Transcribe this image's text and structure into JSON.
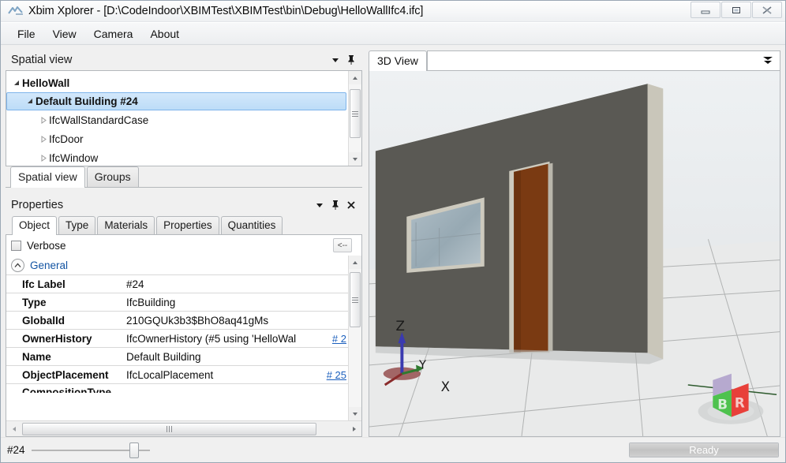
{
  "window": {
    "title": "Xbim Xplorer - [D:\\CodeIndoor\\XBIMTest\\XBIMTest\\bin\\Debug\\HelloWallIfc4.ifc]",
    "app_icon": "xbim-logo-icon",
    "controls": [
      {
        "name": "minimize-button",
        "glyph": "minimize-icon"
      },
      {
        "name": "restore-button",
        "glyph": "restore-icon"
      },
      {
        "name": "close-button",
        "glyph": "close-icon"
      }
    ]
  },
  "menubar": {
    "items": [
      {
        "label": "File"
      },
      {
        "label": "View"
      },
      {
        "label": "Camera"
      },
      {
        "label": "About"
      }
    ]
  },
  "spatial_panel": {
    "title": "Spatial view",
    "header_buttons": [
      {
        "name": "panel-menu-button",
        "icon": "chevron-down-icon"
      },
      {
        "name": "panel-pin-button",
        "icon": "pin-icon"
      }
    ],
    "tree": [
      {
        "label": "HelloWall",
        "level": 0,
        "expander": "expanded",
        "selected": false
      },
      {
        "label": "Default Building #24",
        "level": 1,
        "expander": "expanded",
        "selected": true
      },
      {
        "label": "IfcWallStandardCase",
        "level": 2,
        "expander": "collapsed",
        "selected": false
      },
      {
        "label": "IfcDoor",
        "level": 2,
        "expander": "collapsed",
        "selected": false
      },
      {
        "label": "IfcWindow",
        "level": 2,
        "expander": "collapsed",
        "selected": false
      }
    ],
    "tabs": [
      {
        "label": "Spatial view",
        "active": true
      },
      {
        "label": "Groups",
        "active": false
      }
    ]
  },
  "properties_panel": {
    "title": "Properties",
    "header_buttons": [
      {
        "name": "panel-menu-button",
        "icon": "chevron-down-icon"
      },
      {
        "name": "panel-pin-button",
        "icon": "pin-icon"
      },
      {
        "name": "panel-close-button",
        "icon": "close-icon"
      }
    ],
    "tabs": [
      {
        "label": "Object",
        "active": true
      },
      {
        "label": "Type",
        "active": false
      },
      {
        "label": "Materials",
        "active": false
      },
      {
        "label": "Properties",
        "active": false
      },
      {
        "label": "Quantities",
        "active": false
      }
    ],
    "verbose_label": "Verbose",
    "verbose_checked": false,
    "back_button_label": "<--",
    "section_label": "General",
    "rows": [
      {
        "key": "Ifc Label",
        "value": "#24",
        "link": ""
      },
      {
        "key": "Type",
        "value": "IfcBuilding",
        "link": ""
      },
      {
        "key": "GlobalId",
        "value": "210GQUk3b3$BhO8aq41gMs",
        "link": ""
      },
      {
        "key": "OwnerHistory",
        "value": "IfcOwnerHistory (#5 using 'HelloWal",
        "link": "# 2"
      },
      {
        "key": "Name",
        "value": "Default Building",
        "link": ""
      },
      {
        "key": "ObjectPlacement",
        "value": "IfcLocalPlacement",
        "link": "# 25"
      },
      {
        "key": "CompositionType",
        "value": "",
        "link": ""
      }
    ]
  },
  "view_panel": {
    "tabs": [
      {
        "label": "3D View",
        "active": true
      }
    ],
    "overflow_icon": "double-chevron-down-icon",
    "scene": {
      "axis_gizmo": {
        "x_label": "X",
        "y_label": "Y",
        "z_label": "Z",
        "x_color": "#8a2b2b",
        "y_color": "#2f7a2f",
        "z_color": "#3a3ab0"
      },
      "view_cube": {
        "front_label": "B",
        "side_label": "R",
        "front_color": "#4ec24e",
        "side_color": "#e8403a"
      },
      "wall_color": "#5a5954",
      "wall_edge_color": "#cdcabe",
      "door_color": "#7a3a12",
      "window_color": "#9fb0b8",
      "floor_color": "#e9eaea",
      "grid_color": "#b0b2b2"
    }
  },
  "statusbar": {
    "entity_id": "#24",
    "slider_value": 83,
    "progress_text": "Ready",
    "progress_percent": 100
  }
}
